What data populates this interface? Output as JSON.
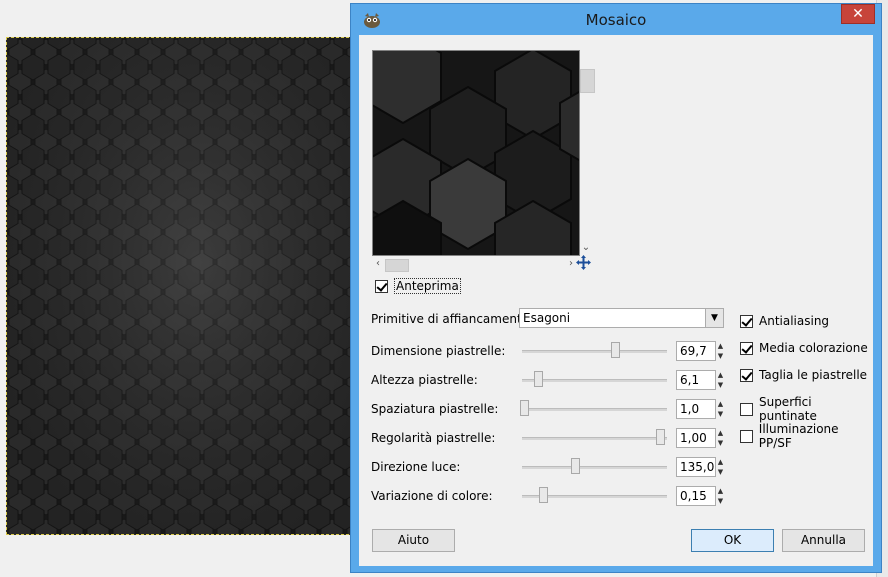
{
  "window": {
    "title": "Mosaico",
    "close_glyph": "✕"
  },
  "preview": {
    "checkbox_label": "Anteprima",
    "checked": true
  },
  "params": {
    "tiling_label": "Primitive di affiancamento:",
    "tiling_value": "Esagoni",
    "rows": [
      {
        "label": "Dimensione piastrelle:",
        "value": "69,7",
        "fraction": 0.65
      },
      {
        "label": "Altezza piastrelle:",
        "value": "6,1",
        "fraction": 0.12
      },
      {
        "label": "Spaziatura piastrelle:",
        "value": "1,0",
        "fraction": 0.02
      },
      {
        "label": "Regolarità piastrelle:",
        "value": "1,00",
        "fraction": 0.96
      },
      {
        "label": "Direzione luce:",
        "value": "135,0",
        "fraction": 0.37
      },
      {
        "label": "Variazione di colore:",
        "value": "0,15",
        "fraction": 0.15
      }
    ]
  },
  "options": [
    {
      "label": "Antialiasing",
      "checked": true
    },
    {
      "label": "Media colorazione",
      "checked": true
    },
    {
      "label": "Taglia le piastrelle",
      "checked": true
    },
    {
      "label": "Superfici puntinate",
      "checked": false
    },
    {
      "label": "Illuminazione PP/SF",
      "checked": false
    }
  ],
  "buttons": {
    "help": "Aiuto",
    "ok": "OK",
    "cancel": "Annulla"
  },
  "icons": {
    "app": "gimp-icon",
    "navigate": "move-icon"
  },
  "colors": {
    "titlebar": "#5aa9ea",
    "close": "#c7443a"
  }
}
